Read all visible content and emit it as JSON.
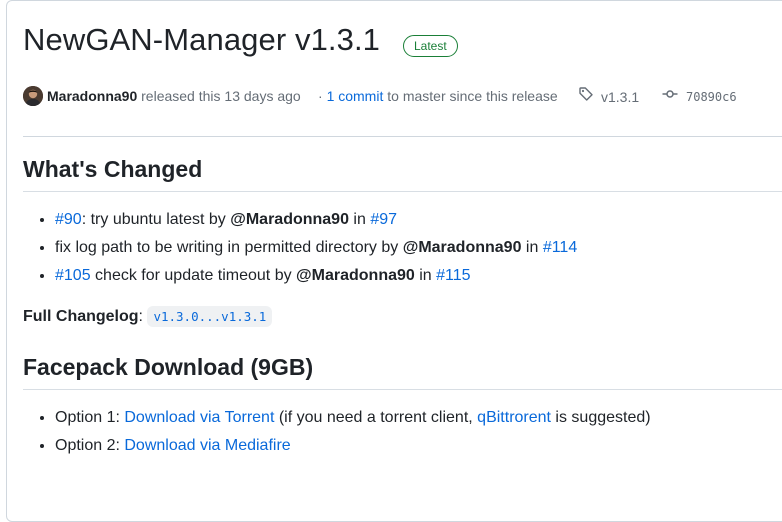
{
  "release": {
    "title": "NewGAN-Manager v1.3.1",
    "badge": "Latest",
    "author": "Maradonna90",
    "released_text": "released this 13 days ago",
    "commit_prefix": "·",
    "commit_link": "1 commit",
    "commit_suffix": "to master since this release",
    "tag": "v1.3.1",
    "sha": "70890c6",
    "icons": {
      "tag": "tag-icon",
      "commit": "git-commit-icon"
    }
  },
  "whats_changed": {
    "heading": "What's Changed",
    "items": [
      {
        "ref": "#90",
        "text1": ": try ubuntu latest by ",
        "user": "@Maradonna90",
        "text2": " in ",
        "pr": "#97"
      },
      {
        "ref": "",
        "text1": "fix log path to be writing in permitted directory by ",
        "user": "@Maradonna90",
        "text2": " in ",
        "pr": "#114"
      },
      {
        "ref": "#105",
        "text1": " check for update timeout by ",
        "user": "@Maradonna90",
        "text2": " in ",
        "pr": "#115"
      }
    ],
    "changelog_label": "Full Changelog",
    "changelog_colon": ":",
    "changelog_link": "v1.3.0...v1.3.1"
  },
  "facepack": {
    "heading": "Facepack Download (9GB)",
    "option1_label": "Option 1: ",
    "option1_link": "Download via Torrent",
    "option1_text_a": " (if you need a torrent client, ",
    "option1_link2": "qBittrorent",
    "option1_text_b": " is suggested)",
    "option2_label": "Option 2: ",
    "option2_link": "Download via Mediafire"
  },
  "colors": {
    "link": "#0969da",
    "badge_green": "#1a7f37",
    "text": "#1f2328",
    "muted": "#656d76",
    "border": "#d0d7de"
  }
}
